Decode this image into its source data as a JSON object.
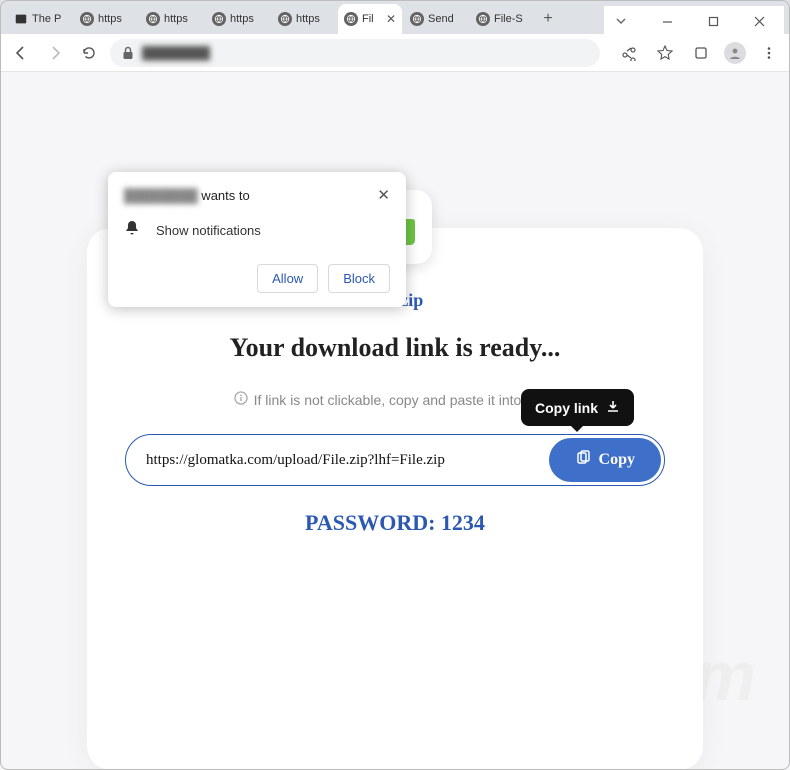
{
  "window": {
    "minimize_icon": "minimize",
    "maximize_icon": "maximize",
    "close_icon": "close"
  },
  "tabs": [
    {
      "label": "The P",
      "favicon": "site"
    },
    {
      "label": "https",
      "favicon": "globe"
    },
    {
      "label": "https",
      "favicon": "globe"
    },
    {
      "label": "https",
      "favicon": "globe"
    },
    {
      "label": "https",
      "favicon": "globe"
    },
    {
      "label": "Fil",
      "favicon": "globe",
      "active": true
    },
    {
      "label": "Send",
      "favicon": "globe"
    },
    {
      "label": "File-S",
      "favicon": "globe"
    }
  ],
  "toolbar": {
    "back_icon": "back",
    "forward_icon": "forward",
    "reload_icon": "reload",
    "lock_icon": "lock",
    "share_icon": "share",
    "star_icon": "star",
    "extensions_icon": "extensions",
    "profile_icon": "profile",
    "menu_icon": "menu",
    "url_blurred": "████████"
  },
  "permission_popup": {
    "site_blurred": "████████",
    "wants_to": " wants to",
    "notify_label": "Show notifications",
    "allow": "Allow",
    "block": "Block"
  },
  "card": {
    "filename": "File.zip",
    "headline": "Your download link is ready...",
    "hint": "If link is not clickable, copy and paste it into the a",
    "link_url": "https://glomatka.com/upload/File.zip?lhf=File.zip",
    "copy_label": "Copy",
    "tooltip_text": "Copy link",
    "password_label": "PASSWORD: 1234"
  },
  "watermark": "pcrisk.com"
}
